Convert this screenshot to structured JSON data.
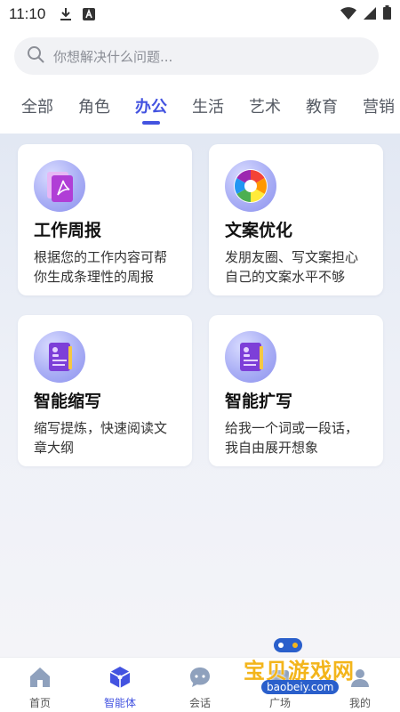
{
  "status_bar": {
    "time": "11:10"
  },
  "search": {
    "placeholder": "你想解决什么问题..."
  },
  "tabs": [
    {
      "label": "全部"
    },
    {
      "label": "角色"
    },
    {
      "label": "办公"
    },
    {
      "label": "生活"
    },
    {
      "label": "艺术"
    },
    {
      "label": "教育"
    },
    {
      "label": "营销"
    }
  ],
  "active_tab": "办公",
  "cards": [
    {
      "title": "工作周报",
      "desc": "根据您的工作内容可帮你生成条理性的周报",
      "icon": "pdf-document-icon"
    },
    {
      "title": "文案优化",
      "desc": "发朋友圈、写文案担心自己的文案水平不够",
      "icon": "color-aperture-icon"
    },
    {
      "title": "智能缩写",
      "desc": "缩写提炼，快速阅读文章大纲",
      "icon": "profile-document-icon"
    },
    {
      "title": "智能扩写",
      "desc": "给我一个词或一段话，我自由展开想象",
      "icon": "profile-document-icon"
    }
  ],
  "bottom_nav": [
    {
      "label": "首页",
      "icon": "home-icon"
    },
    {
      "label": "智能体",
      "icon": "cube-icon"
    },
    {
      "label": "会话",
      "icon": "chat-bubble-icon"
    },
    {
      "label": "广场",
      "icon": "plaza-icon"
    },
    {
      "label": "我的",
      "icon": "user-icon"
    }
  ],
  "watermark": {
    "text": "宝贝游戏网",
    "url": "baobeiy.com"
  },
  "colors": {
    "accent": "#4353e0",
    "watermark_yellow": "#f3b51b"
  }
}
